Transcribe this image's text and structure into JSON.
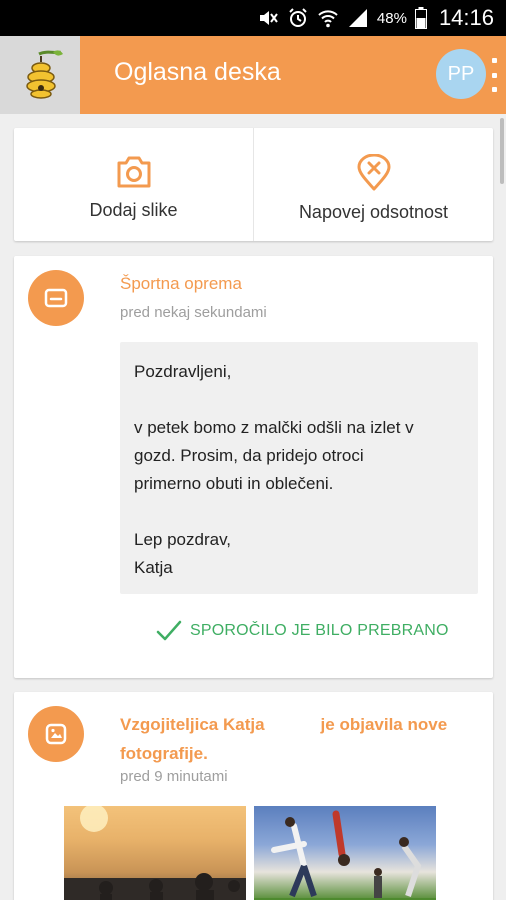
{
  "status_bar": {
    "battery_percent": "48%",
    "time": "14:16"
  },
  "app_bar": {
    "title": "Oglasna deska",
    "avatar_initials": "PP"
  },
  "actions": {
    "add_photos_label": "Dodaj slike",
    "announce_absence_label": "Napovej odsotnost"
  },
  "message_post": {
    "title": "Športna oprema",
    "time": "pred nekaj sekundami",
    "body": {
      "greeting": "Pozdravljeni,",
      "line1": "v petek bomo z malčki odšli na izlet v",
      "line2": "gozd. Prosim, da pridejo otroci",
      "line3": "primerno obuti in oblečeni.",
      "closing": "Lep pozdrav,",
      "signature": "Katja"
    },
    "read_status": "SPOROČILO JE BILO PREBRANO"
  },
  "photo_post": {
    "author": "Vzgojiteljica Katja",
    "action_line1": "je objavila nove",
    "action_line2": "fotografije.",
    "time": "pred 9 minutami"
  },
  "colors": {
    "accent": "#f39a4f",
    "read_green": "#3fae63",
    "avatar_bg": "#a9d5f0"
  }
}
